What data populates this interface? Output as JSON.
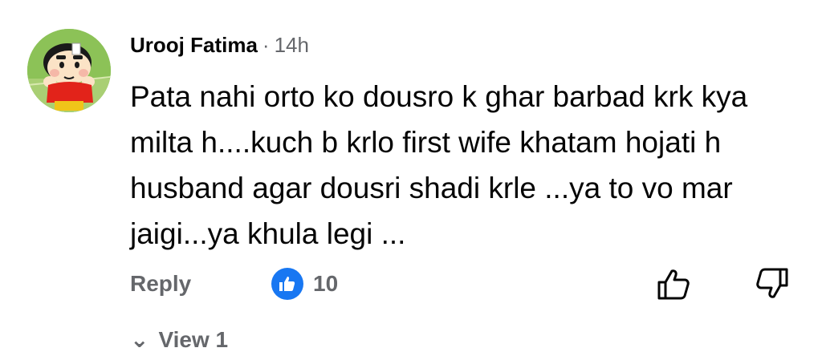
{
  "comment": {
    "author": "Urooj Fatima",
    "separator": "·",
    "timestamp": "14h",
    "text": "Pata nahi orto ko dousro k ghar barbad krk kya milta h....kuch b krlo first wife khatam hojati h husband agar dousri shadi krle ...ya to vo mar jaigi...ya khula legi ...",
    "avatar_icon": "cartoon-avatar"
  },
  "actions": {
    "reply_label": "Reply",
    "reaction_icon": "like-icon",
    "reaction_count": "10",
    "upvote_icon": "thumbs-up-icon",
    "downvote_icon": "thumbs-down-icon"
  },
  "replies": {
    "chevron": "⌄",
    "label": "View 1"
  },
  "colors": {
    "text": "#050505",
    "secondary": "#65676b",
    "like_blue": "#1877f2"
  }
}
